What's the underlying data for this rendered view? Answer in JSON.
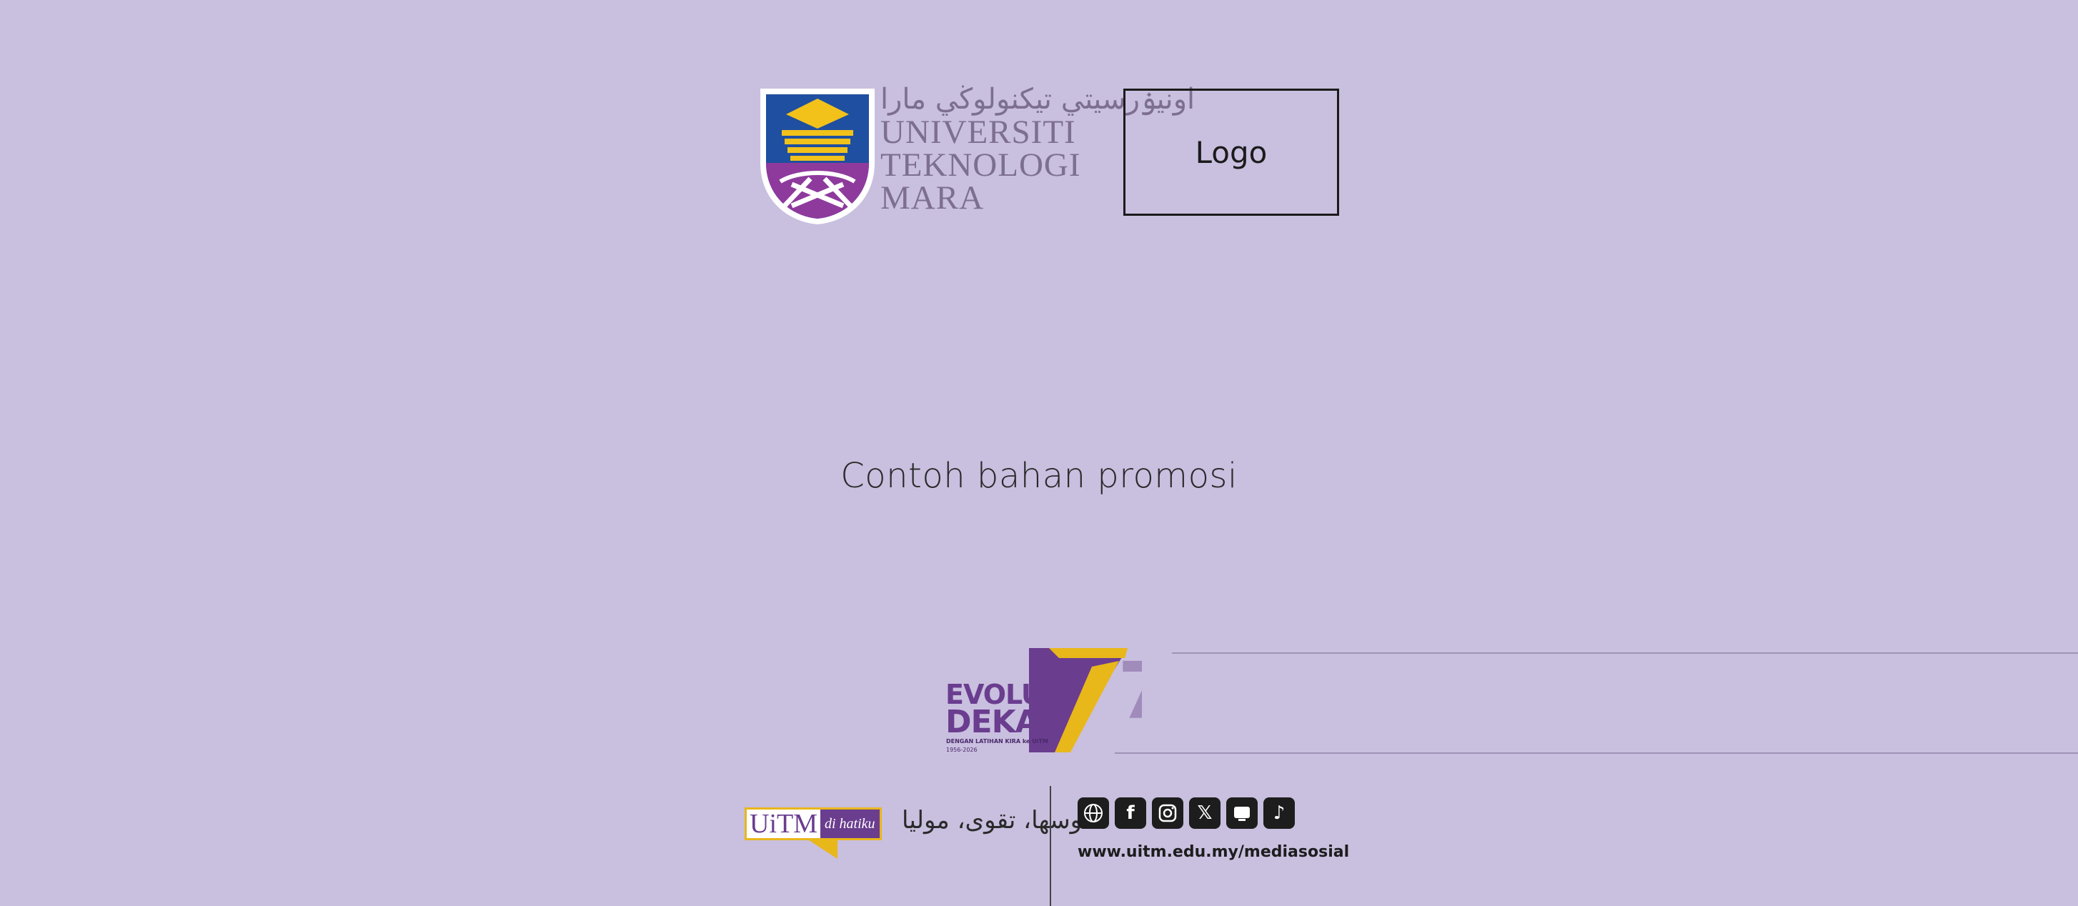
{
  "header": {
    "uitm_logo": {
      "jawi": "اونيۏرسيتي تيکنولوڬي مارا",
      "line1": "UNIVERSITI",
      "line2": "TEKNOLOGI",
      "line3": "MARA"
    },
    "placeholder_logo_label": "Logo"
  },
  "main": {
    "promo_text": "Contoh bahan promosi"
  },
  "badge": {
    "line1": "EVOLUSI",
    "line2": "DEKAD",
    "sub": "DENGAN LATIHAN KIRA ke UiTM",
    "years": "1956-2026"
  },
  "footer": {
    "uitm_dihatiku_main": "UiTM",
    "uitm_dihatiku_tag": "di hatiku",
    "jawi_motto": "اوسها، تقوى، موليا",
    "social_url": "www.uitm.edu.my/mediasosial",
    "social_icons": [
      "globe-icon",
      "facebook-icon",
      "instagram-icon",
      "x-icon",
      "uitm-app-icon",
      "tiktok-icon"
    ]
  },
  "colors": {
    "background": "#c9bfdf",
    "purple": "#6a3d8f",
    "gold": "#e8b71a",
    "dark": "#1d1d1d"
  }
}
